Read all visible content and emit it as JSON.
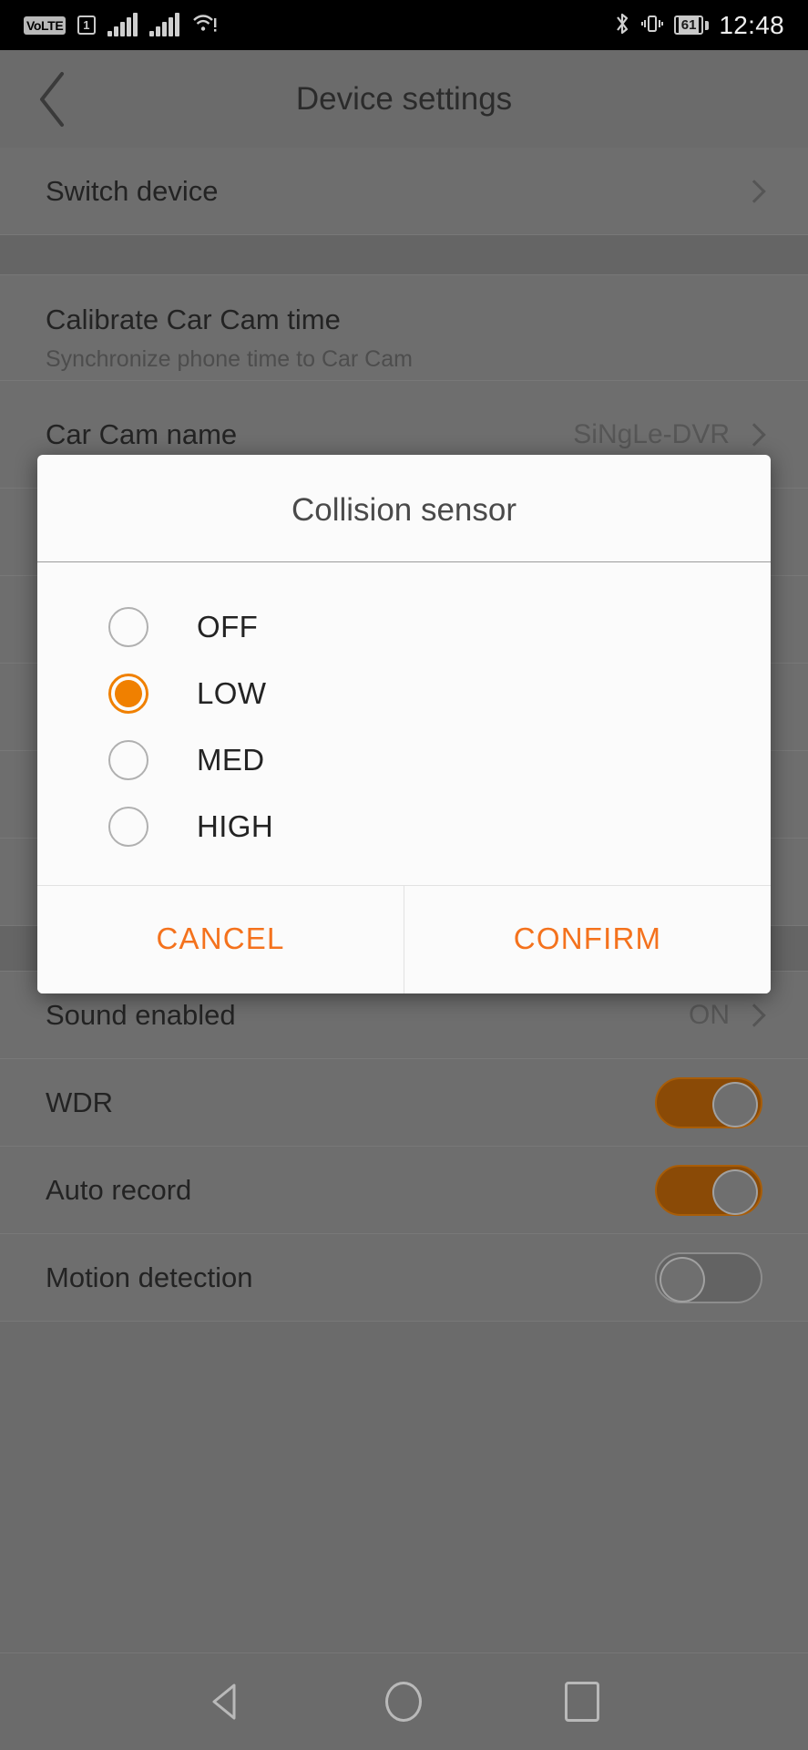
{
  "statusbar": {
    "volte": "VoLTE",
    "sim": "1",
    "battery_percent": "61",
    "time": "12:48",
    "icons": [
      "volte-icon",
      "sim1-icon",
      "signal-bars-icon",
      "signal-bars-icon",
      "wifi-alert-icon",
      "bluetooth-icon",
      "vibrate-icon",
      "battery-icon"
    ]
  },
  "appbar": {
    "title": "Device settings",
    "back_icon": "back-chevron-icon"
  },
  "settings": {
    "rows": [
      {
        "title": "Switch device",
        "value": "",
        "accessory": "chevron"
      },
      {
        "title": "Calibrate Car Cam time",
        "subtitle": "Synchronize phone time to Car Cam",
        "value": "",
        "accessory": "none"
      },
      {
        "title": "Car Cam name",
        "value": "SiNgLe-DVR",
        "accessory": "chevron"
      },
      {
        "title": "Sound enabled",
        "value": "ON",
        "accessory": "chevron"
      },
      {
        "title": "WDR",
        "value": "",
        "accessory": "toggle",
        "toggle_on": true
      },
      {
        "title": "Auto record",
        "value": "",
        "accessory": "toggle",
        "toggle_on": true
      },
      {
        "title": "Motion detection",
        "value": "",
        "accessory": "toggle",
        "toggle_on": false
      }
    ]
  },
  "dialog": {
    "title": "Collision sensor",
    "options": [
      {
        "label": "OFF",
        "selected": false
      },
      {
        "label": "LOW",
        "selected": true
      },
      {
        "label": "MED",
        "selected": false
      },
      {
        "label": "HIGH",
        "selected": false
      }
    ],
    "cancel_label": "CANCEL",
    "confirm_label": "CONFIRM",
    "accent_color": "#f4721d"
  },
  "navbar": {
    "back": "back-triangle-icon",
    "home": "home-circle-icon",
    "recents": "recents-square-icon"
  }
}
